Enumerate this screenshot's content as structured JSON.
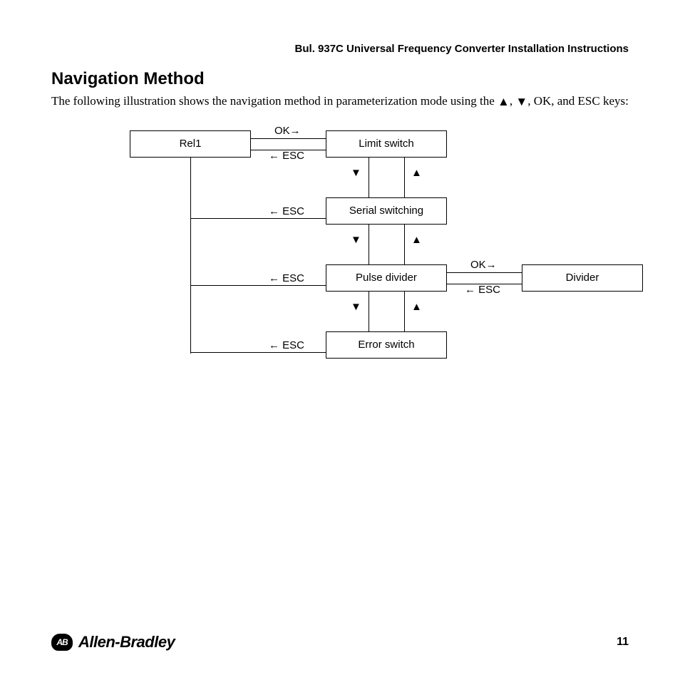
{
  "header": {
    "title": "Bul. 937C Universal Frequency Converter Installation Instructions"
  },
  "section": {
    "heading": "Navigation Method",
    "body_pre": "The following illustration shows the navigation method in parameterization mode using the ",
    "body_mid1": ", ",
    "body_mid2": ", OK, and ESC keys:"
  },
  "diagram": {
    "nodes": {
      "rel1": "Rel1",
      "limit_switch": "Limit switch",
      "serial_switching": "Serial switching",
      "pulse_divider": "Pulse divider",
      "error_switch": "Error switch",
      "divider": "Divider"
    },
    "labels": {
      "ok_arrow": "OK→",
      "esc_arrow": "← ESC"
    }
  },
  "footer": {
    "brand": "Allen-Bradley",
    "brand_logo_text": "AB",
    "page_number": "11"
  }
}
